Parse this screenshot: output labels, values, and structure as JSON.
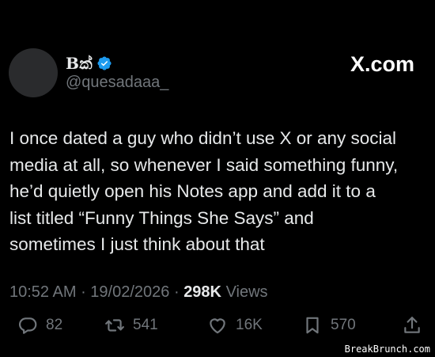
{
  "author": {
    "display_name": "Bක්",
    "handle": "@quesadaaa_",
    "verified": true
  },
  "brand": "X.com",
  "tweet": {
    "text": "I once dated a guy who didn’t use X or any social\nmedia at all, so whenever I said something funny,\nhe’d quietly open his Notes app and add it to a\nlist titled “Funny Things She Says” and\nsometimes I just think about that"
  },
  "meta": {
    "time": "10:52 AM",
    "date": "19/02/2026",
    "views_count": "298K",
    "views_label": "Views",
    "separator": " · "
  },
  "actions": {
    "replies": "82",
    "reposts": "541",
    "likes": "16K",
    "bookmarks": "570"
  },
  "watermark": "BreakBrunch.com",
  "colors": {
    "background": "#000000",
    "text": "#e7e9ea",
    "muted": "#71767b",
    "verified": "#1d9bf0"
  },
  "icons": {
    "reply": "reply-icon",
    "repost": "repost-icon",
    "like": "heart-icon",
    "bookmark": "bookmark-icon",
    "share": "share-icon",
    "verified": "verified-badge-icon"
  }
}
